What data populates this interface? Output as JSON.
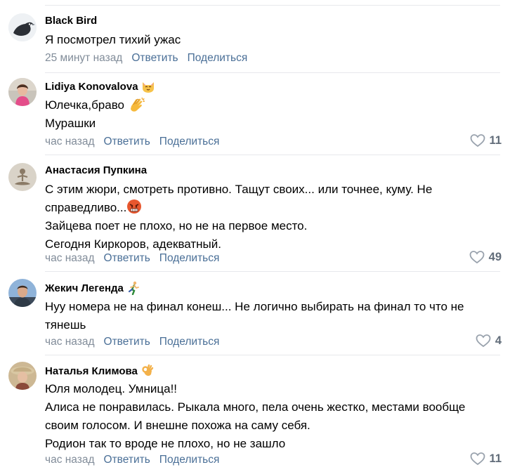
{
  "comments": [
    {
      "author": "Black Bird",
      "author_emoji": "",
      "lines": [
        "Я посмотрел тихий ужас"
      ],
      "time": "25 минут назад",
      "reply_label": "Ответить",
      "share_label": "Поделиться",
      "likes": ""
    },
    {
      "author": "Lidiya Konovalova",
      "author_emoji": "cat-face-icon",
      "lines": [
        "Юлечка,браво",
        "Мурашки"
      ],
      "time": "час назад",
      "reply_label": "Ответить",
      "share_label": "Поделиться",
      "likes": "11"
    },
    {
      "author": "Анастасия Пупкина",
      "author_emoji": "",
      "lines": [
        "С этим жюри, смотреть противно. Тащут своих... или точнее, куму. Не",
        "справедливо...",
        "Зайцева поет не плохо, но не на первое место.",
        "Сегодня Киркоров, адекватный."
      ],
      "time": "час назад",
      "reply_label": "Ответить",
      "share_label": "Поделиться",
      "likes": "49"
    },
    {
      "author": "Жекич Легенда",
      "author_emoji": "runner-icon",
      "lines": [
        "Нуу номера не на финал конеш... Не логично выбирать на финал то что не",
        "тянешь"
      ],
      "time": "час назад",
      "reply_label": "Ответить",
      "share_label": "Поделиться",
      "likes": "4"
    },
    {
      "author": "Наталья Климова",
      "author_emoji": "ok-hand-icon",
      "lines": [
        "Юля молодец. Умница!!",
        "Алиса не понравилась. Рыкала много, пела очень жестко, местами вообще",
        "своим голосом. И внешне похожа на саму себя.",
        "Родион так то вроде не плохо, но не зашло"
      ],
      "time": "час назад",
      "reply_label": "Ответить",
      "share_label": "Поделиться",
      "likes": "11"
    }
  ],
  "inline_emojis": {
    "clapping": "clapping-hands-icon",
    "angry": "angry-face-icon"
  },
  "colors": {
    "meta_gray": "#818c99",
    "divider": "#e7e8ec",
    "like_gray": "#626d7a"
  }
}
